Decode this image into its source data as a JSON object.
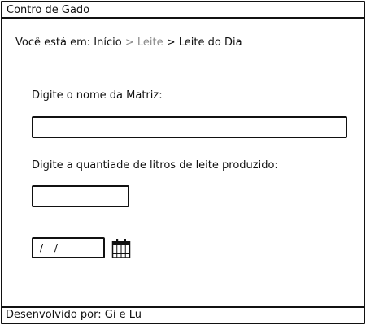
{
  "window": {
    "title": "Contro de Gado"
  },
  "breadcrumb": {
    "prefix": "Você está em:",
    "home": "Início",
    "sep1": ">",
    "section": "Leite",
    "sep2": ">",
    "current": "Leite do Dia"
  },
  "form": {
    "matriz_label": "Digite o nome da Matriz:",
    "matriz_value": "",
    "litros_label": "Digite a quantiade de litros de leite produzido:",
    "litros_value": "",
    "date_value": "/ /"
  },
  "icons": {
    "calendar": "calendar-icon"
  },
  "footer": {
    "credit": "Desenvolvido por: Gi e Lu"
  }
}
